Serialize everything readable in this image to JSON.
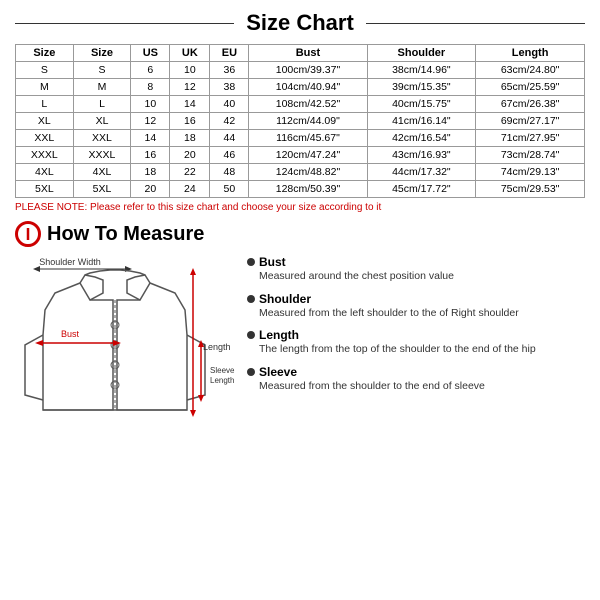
{
  "title": "Size Chart",
  "table": {
    "headers": [
      "Size",
      "Size",
      "US",
      "UK",
      "EU",
      "Bust",
      "Shoulder",
      "Length"
    ],
    "rows": [
      [
        "S",
        "S",
        "6",
        "10",
        "36",
        "100cm/39.37\"",
        "38cm/14.96\"",
        "63cm/24.80\""
      ],
      [
        "M",
        "M",
        "8",
        "12",
        "38",
        "104cm/40.94\"",
        "39cm/15.35\"",
        "65cm/25.59\""
      ],
      [
        "L",
        "L",
        "10",
        "14",
        "40",
        "108cm/42.52\"",
        "40cm/15.75\"",
        "67cm/26.38\""
      ],
      [
        "XL",
        "XL",
        "12",
        "16",
        "42",
        "112cm/44.09\"",
        "41cm/16.14\"",
        "69cm/27.17\""
      ],
      [
        "XXL",
        "XXL",
        "14",
        "18",
        "44",
        "116cm/45.67\"",
        "42cm/16.54\"",
        "71cm/27.95\""
      ],
      [
        "XXXL",
        "XXXL",
        "16",
        "20",
        "46",
        "120cm/47.24\"",
        "43cm/16.93\"",
        "73cm/28.74\""
      ],
      [
        "4XL",
        "4XL",
        "18",
        "22",
        "48",
        "124cm/48.82\"",
        "44cm/17.32\"",
        "74cm/29.13\""
      ],
      [
        "5XL",
        "5XL",
        "20",
        "24",
        "50",
        "128cm/50.39\"",
        "45cm/17.72\"",
        "75cm/29.53\""
      ]
    ]
  },
  "note": "PLEASE NOTE: Please refer to this size chart and choose your size according to it",
  "how_to_measure": {
    "title": "How To Measure",
    "measurements": [
      {
        "name": "Bust",
        "desc": "Measured around the chest position value"
      },
      {
        "name": "Shoulder",
        "desc": "Measured from the left shoulder to the of Right shoulder"
      },
      {
        "name": "Length",
        "desc": "The length from the top of the shoulder to the end of the hip"
      },
      {
        "name": "Sleeve",
        "desc": "Measured from the shoulder to the end of sleeve"
      }
    ],
    "jacket_labels": {
      "shoulder_width": "Shoulder Width",
      "bust": "Bust",
      "sleeve_length": "Sleeve\nLength",
      "length": "Length"
    }
  }
}
